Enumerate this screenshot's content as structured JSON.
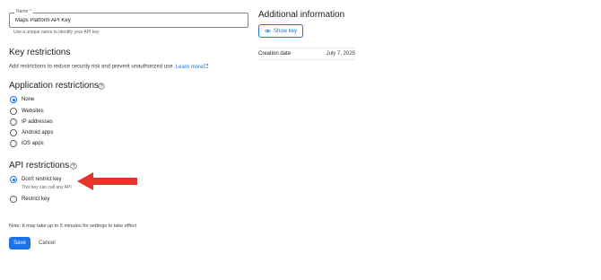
{
  "name_field": {
    "label": "Name *",
    "value": "Maps Platform API Key",
    "helper": "Use a unique name to identify your API key"
  },
  "key_restrictions": {
    "title": "Key restrictions",
    "description": "Add restrictions to reduce security risk and prevent unauthorized use.",
    "link": "Learn more"
  },
  "application_restrictions": {
    "title": "Application restrictions",
    "options": [
      {
        "label": "None",
        "checked": true
      },
      {
        "label": "Websites",
        "checked": false
      },
      {
        "label": "IP addresses",
        "checked": false
      },
      {
        "label": "Android apps",
        "checked": false
      },
      {
        "label": "iOS apps",
        "checked": false
      }
    ]
  },
  "api_restrictions": {
    "title": "API restrictions",
    "options": [
      {
        "label": "Don't restrict key",
        "sublabel": "This key can call any API",
        "checked": true
      },
      {
        "label": "Restrict key",
        "checked": false
      }
    ]
  },
  "note": "Note: It may take up to 5 minutes for settings to take effect",
  "actions": {
    "save": "Save",
    "cancel": "Cancel"
  },
  "additional_info": {
    "title": "Additional information",
    "show_key": "Show key",
    "creation_label": "Creation date",
    "creation_value": "July 7, 2025"
  },
  "colors": {
    "accent": "#1a73e8",
    "annotation_arrow": "#e8332a"
  },
  "icons": [
    "help-icon",
    "external-link-icon",
    "eye-icon",
    "arrow-annotation"
  ]
}
